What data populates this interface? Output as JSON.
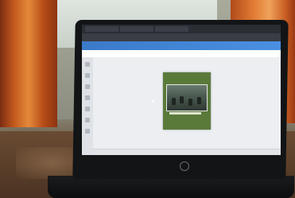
{
  "app": {
    "window_title": "",
    "tab_titles": [],
    "menu_items": [],
    "page_label": "",
    "status_text": "",
    "zoom_text": ""
  },
  "colors": {
    "accent": "#4a90e2",
    "page_background": "#5a7a3a"
  },
  "icons": {
    "rail": [
      "home-icon",
      "template-icon",
      "elements-icon",
      "upload-icon",
      "text-icon",
      "apps-icon",
      "more-icon"
    ]
  }
}
